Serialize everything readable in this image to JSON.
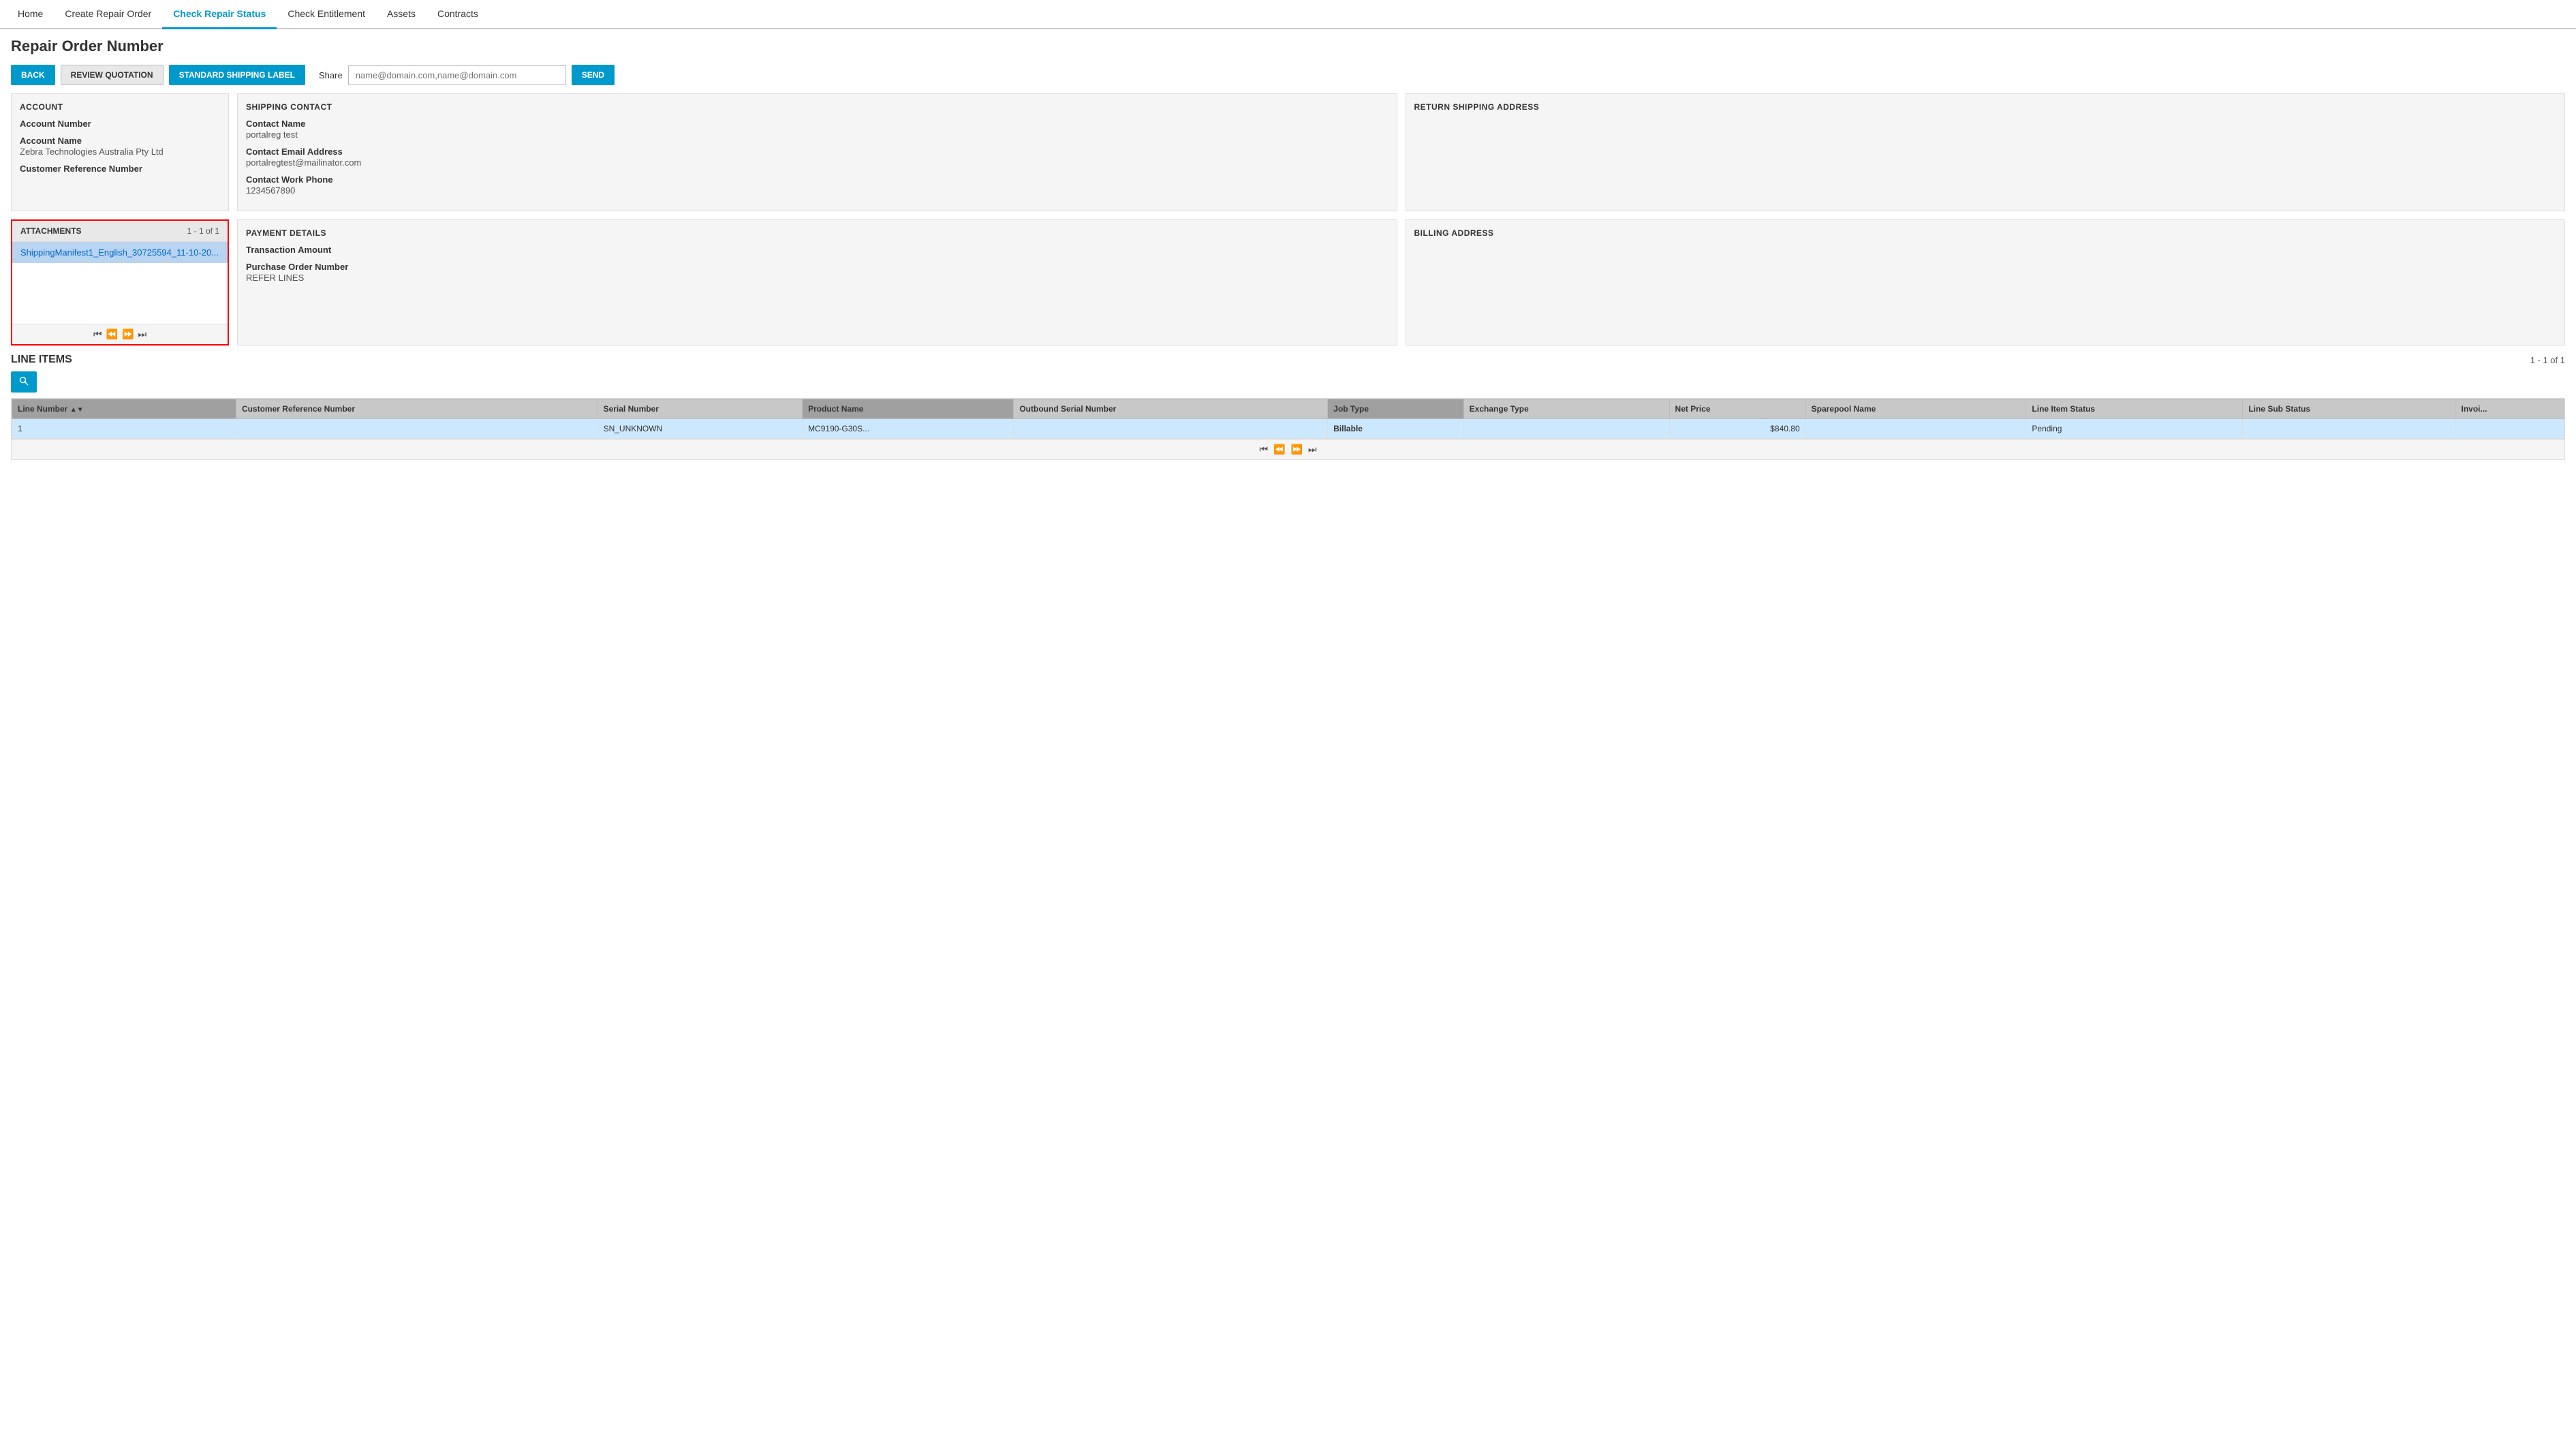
{
  "nav": {
    "items": [
      {
        "id": "home",
        "label": "Home",
        "active": false
      },
      {
        "id": "create-repair-order",
        "label": "Create Repair Order",
        "active": false
      },
      {
        "id": "check-repair-status",
        "label": "Check Repair Status",
        "active": true
      },
      {
        "id": "check-entitlement",
        "label": "Check Entitlement",
        "active": false
      },
      {
        "id": "assets",
        "label": "Assets",
        "active": false
      },
      {
        "id": "contracts",
        "label": "Contracts",
        "active": false
      }
    ]
  },
  "page": {
    "title": "Repair Order Number",
    "back_label": "BACK",
    "review_label": "REVIEW QUOTATION",
    "shipping_label": "STANDARD SHIPPING LABEL",
    "share_label": "Share",
    "share_placeholder": "name@domain.com,name@domain.com",
    "send_label": "SEND"
  },
  "account": {
    "title": "ACCOUNT",
    "account_number_label": "Account Number",
    "account_number_value": "",
    "account_name_label": "Account Name",
    "account_name_value": "Zebra Technologies Australia Pty Ltd",
    "customer_ref_label": "Customer Reference Number",
    "customer_ref_value": ""
  },
  "shipping_contact": {
    "title": "SHIPPING CONTACT",
    "contact_name_label": "Contact Name",
    "contact_name_value": "portalreg test",
    "email_label": "Contact Email Address",
    "email_value": "portalregtest@mailinator.com",
    "phone_label": "Contact Work Phone",
    "phone_value": "1234567890"
  },
  "return_shipping": {
    "title": "RETURN SHIPPING ADDRESS"
  },
  "attachments": {
    "title": "ATTACHMENTS",
    "count": "1 - 1 of 1",
    "items": [
      {
        "name": "ShippingManifest1_English_30725594_11-10-20..."
      }
    ]
  },
  "payment_details": {
    "title": "PAYMENT DETAILS",
    "transaction_amount_label": "Transaction Amount",
    "transaction_amount_value": "",
    "purchase_order_label": "Purchase Order Number",
    "purchase_order_value": "REFER LINES"
  },
  "billing_address": {
    "title": "BILLING ADDRESS"
  },
  "line_items": {
    "title": "LINE ITEMS",
    "count": "1 - 1 of 1",
    "columns": [
      {
        "id": "line-number",
        "label": "Line Number",
        "sorted": true,
        "sort_dir": "▲▼"
      },
      {
        "id": "customer-ref",
        "label": "Customer Reference Number"
      },
      {
        "id": "serial-number",
        "label": "Serial Number"
      },
      {
        "id": "product-name",
        "label": "Product Name",
        "highlight": true
      },
      {
        "id": "outbound-serial",
        "label": "Outbound Serial Number"
      },
      {
        "id": "job-type",
        "label": "Job Type",
        "highlight": true
      },
      {
        "id": "exchange-type",
        "label": "Exchange Type"
      },
      {
        "id": "net-price",
        "label": "Net Price"
      },
      {
        "id": "sparepool-name",
        "label": "Sparepool Name"
      },
      {
        "id": "line-item-status",
        "label": "Line Item Status"
      },
      {
        "id": "line-sub-status",
        "label": "Line Sub Status"
      },
      {
        "id": "invoice",
        "label": "Invoi..."
      }
    ],
    "rows": [
      {
        "line_number": "1",
        "customer_ref": "",
        "serial_number": "SN_UNKNOWN",
        "product_name": "MC9190-G30S...",
        "outbound_serial": "",
        "job_type": "Billable",
        "exchange_type": "",
        "net_price": "$840.80",
        "sparepool_name": "",
        "line_item_status": "Pending",
        "line_sub_status": "",
        "invoice": ""
      }
    ]
  }
}
